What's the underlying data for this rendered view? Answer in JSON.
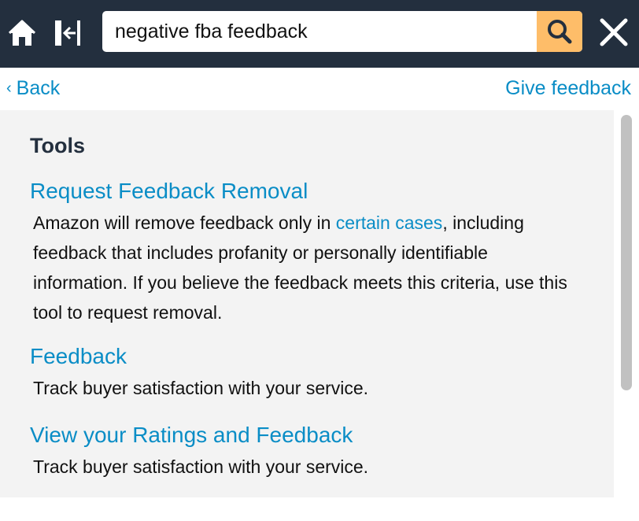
{
  "header": {
    "home_icon": "home-icon",
    "collapse_icon": "collapse-panel-icon",
    "search": {
      "value": "negative fba feedback",
      "placeholder": ""
    },
    "search_button_icon": "search-icon",
    "close_icon": "close-icon",
    "colors": {
      "bar": "#232f3e",
      "search_button": "#febd69"
    }
  },
  "nav": {
    "back_chevron": "‹",
    "back_label": "Back",
    "give_feedback_label": "Give feedback"
  },
  "tools": {
    "title": "Tools",
    "items": [
      {
        "title": "Request Feedback Removal",
        "desc_before": "Amazon will remove feedback only in ",
        "desc_link": "certain cases",
        "desc_after": ", including feedback that includes profanity or personally identifiable information. If you believe the feedback meets this criteria, use this tool to request removal."
      },
      {
        "title": "Feedback",
        "desc": "Track buyer satisfaction with your service."
      },
      {
        "title": "View your Ratings and Feedback",
        "desc": "Track buyer satisfaction with your service."
      }
    ]
  },
  "colors": {
    "link": "#0a8dc6",
    "content_bg": "#f3f3f3",
    "text": "#111111"
  }
}
